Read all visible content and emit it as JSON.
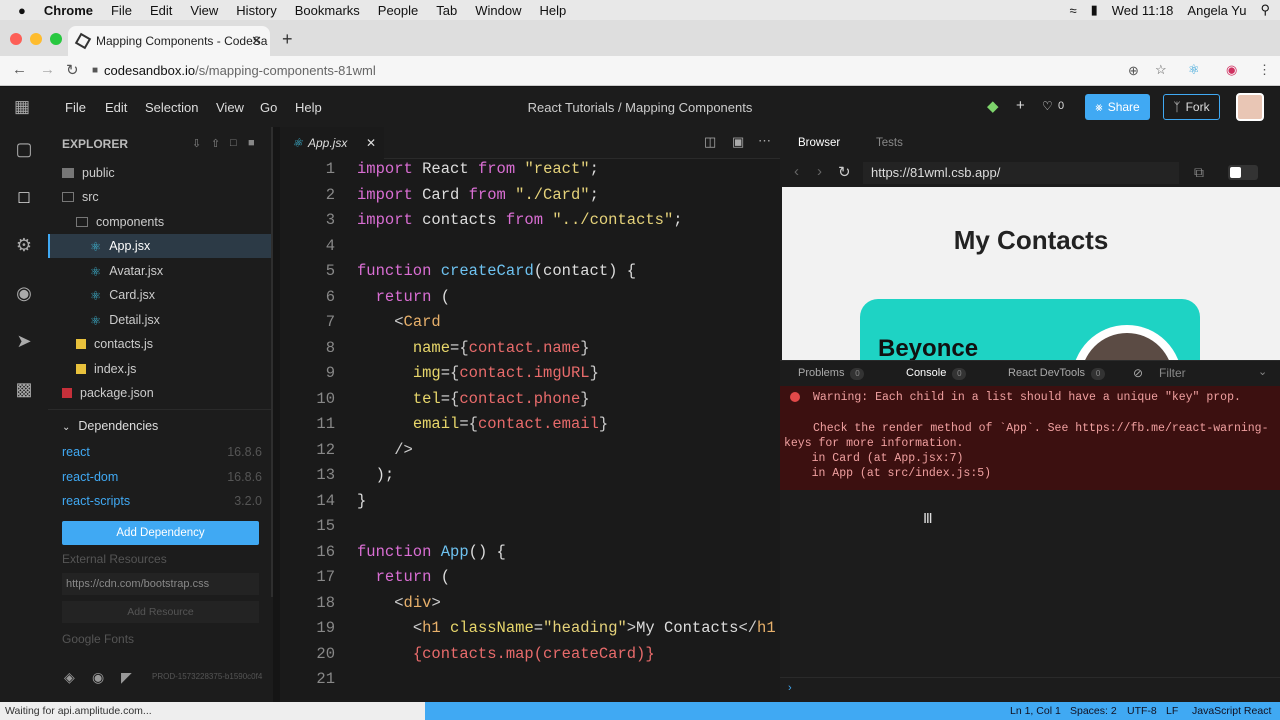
{
  "menubar": {
    "apple": "",
    "app": "Chrome",
    "items": [
      "File",
      "Edit",
      "View",
      "History",
      "Bookmarks",
      "People",
      "Tab",
      "Window",
      "Help"
    ],
    "clock": "Wed 11:18",
    "user": "Angela Yu"
  },
  "browser": {
    "tab_title": "Mapping Components - CodeSa",
    "url_host": "codesandbox.io",
    "url_path": "/s/mapping-components-81wml"
  },
  "csb": {
    "menu": [
      "File",
      "Edit",
      "Selection",
      "View",
      "Go",
      "Help"
    ],
    "title": "React Tutorials / Mapping Components",
    "likes": "0",
    "share": "Share",
    "fork": "Fork"
  },
  "explorer": {
    "title": "EXPLORER",
    "files": [
      {
        "name": "public",
        "type": "folder"
      },
      {
        "name": "src",
        "type": "folder"
      },
      {
        "name": "components",
        "type": "folder"
      },
      {
        "name": "App.jsx",
        "type": "react"
      },
      {
        "name": "Avatar.jsx",
        "type": "react"
      },
      {
        "name": "Card.jsx",
        "type": "react"
      },
      {
        "name": "Detail.jsx",
        "type": "react"
      },
      {
        "name": "contacts.js",
        "type": "js"
      },
      {
        "name": "index.js",
        "type": "js"
      },
      {
        "name": "package.json",
        "type": "npm"
      }
    ],
    "deps_title": "Dependencies",
    "deps": [
      {
        "name": "react",
        "version": "16.8.6"
      },
      {
        "name": "react-dom",
        "version": "16.8.6"
      },
      {
        "name": "react-scripts",
        "version": "3.2.0"
      }
    ],
    "add_dep": "Add Dependency",
    "external_title": "External Resources",
    "external_placeholder": "https://cdn.com/bootstrap.css",
    "add_resource": "Add Resource",
    "google_fonts": "Google Fonts",
    "build_id": "PROD-1573228375-b1590c0f4"
  },
  "editor": {
    "filename": "App.jsx",
    "lines": [
      "1",
      "2",
      "3",
      "4",
      "5",
      "6",
      "7",
      "8",
      "9",
      "10",
      "11",
      "12",
      "13",
      "14",
      "15",
      "16",
      "17",
      "18",
      "19",
      "20",
      "21"
    ]
  },
  "preview": {
    "tabs": [
      "Browser",
      "Tests"
    ],
    "url": "https://81wml.csb.app/",
    "heading": "My Contacts",
    "card_name": "Beyonce"
  },
  "devtools": {
    "tabs": [
      {
        "label": "Problems",
        "count": "0"
      },
      {
        "label": "Console",
        "count": "0"
      },
      {
        "label": "React DevTools",
        "count": "0"
      }
    ],
    "filter": "Filter",
    "warning": [
      "Warning: Each child in a list should have a unique \"key\" prop.",
      "",
      "Check the render method of `App`. See https://fb.me/react-warning-",
      "keys for more information.",
      "    in Card (at App.jsx:7)",
      "    in App (at src/index.js:5)"
    ]
  },
  "status": {
    "waiting": "Waiting for api.amplitude.com...",
    "pos": "Ln 1, Col 1",
    "spaces": "Spaces: 2",
    "enc": "UTF-8",
    "eol": "LF",
    "lang": "JavaScript React"
  },
  "colors": {
    "accent": "#40a9f3",
    "card": "#1ed3c4",
    "warning_bg": "#3c1010"
  }
}
